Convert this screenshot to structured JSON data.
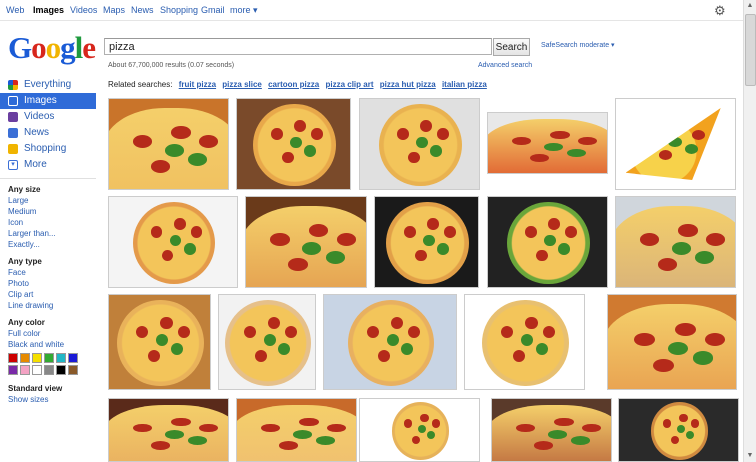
{
  "topnav": [
    {
      "label": "Web",
      "active": false
    },
    {
      "label": "Images",
      "active": true
    },
    {
      "label": "Videos",
      "active": false
    },
    {
      "label": "Maps",
      "active": false
    },
    {
      "label": "News",
      "active": false
    },
    {
      "label": "Shopping",
      "active": false
    },
    {
      "label": "Gmail",
      "active": false
    },
    {
      "label": "more ▾",
      "active": false
    }
  ],
  "search": {
    "query": "pizza",
    "button": "Search",
    "safesearch": "SafeSearch moderate ▾"
  },
  "stats": "About 67,700,000 results (0.07 seconds)",
  "advanced": "Advanced search",
  "related": {
    "label": "Related searches:",
    "items": [
      "fruit pizza",
      "pizza slice",
      "cartoon pizza",
      "pizza clip art",
      "pizza hut pizza",
      "italian pizza"
    ]
  },
  "sidebar": [
    {
      "label": "Everything",
      "icon": "multicolor-icon",
      "color": "#e8a317",
      "selected": false
    },
    {
      "label": "Images",
      "icon": "camera-icon",
      "color": "#ffffff",
      "selected": true
    },
    {
      "label": "Videos",
      "icon": "film-icon",
      "color": "#6b3fa0",
      "selected": false
    },
    {
      "label": "News",
      "icon": "news-icon",
      "color": "#3b6fd6",
      "selected": false
    },
    {
      "label": "Shopping",
      "icon": "tag-icon",
      "color": "#f0b400",
      "selected": false
    },
    {
      "label": "More",
      "icon": "more-icon",
      "color": "#3b6fd6",
      "selected": false
    }
  ],
  "filters": [
    {
      "heading": "Any size",
      "links": [
        "Large",
        "Medium",
        "Icon",
        "Larger than...",
        "Exactly..."
      ]
    },
    {
      "heading": "Any type",
      "links": [
        "Face",
        "Photo",
        "Clip art",
        "Line drawing"
      ]
    },
    {
      "heading": "Any color",
      "links": [
        "Full color",
        "Black and white"
      ]
    }
  ],
  "colors": [
    "#cc0000",
    "#e68a00",
    "#f5e000",
    "#33aa33",
    "#22b7c6",
    "#1a1ad6",
    "#7a2aa8",
    "#f4a3c4",
    "#ffffff",
    "#888888",
    "#000000",
    "#8a5a2a"
  ],
  "standard_view": {
    "heading": "Standard view",
    "link": "Show sizes"
  },
  "brand": {
    "accent": "#2f6bd8",
    "link": "#2a5db0"
  }
}
